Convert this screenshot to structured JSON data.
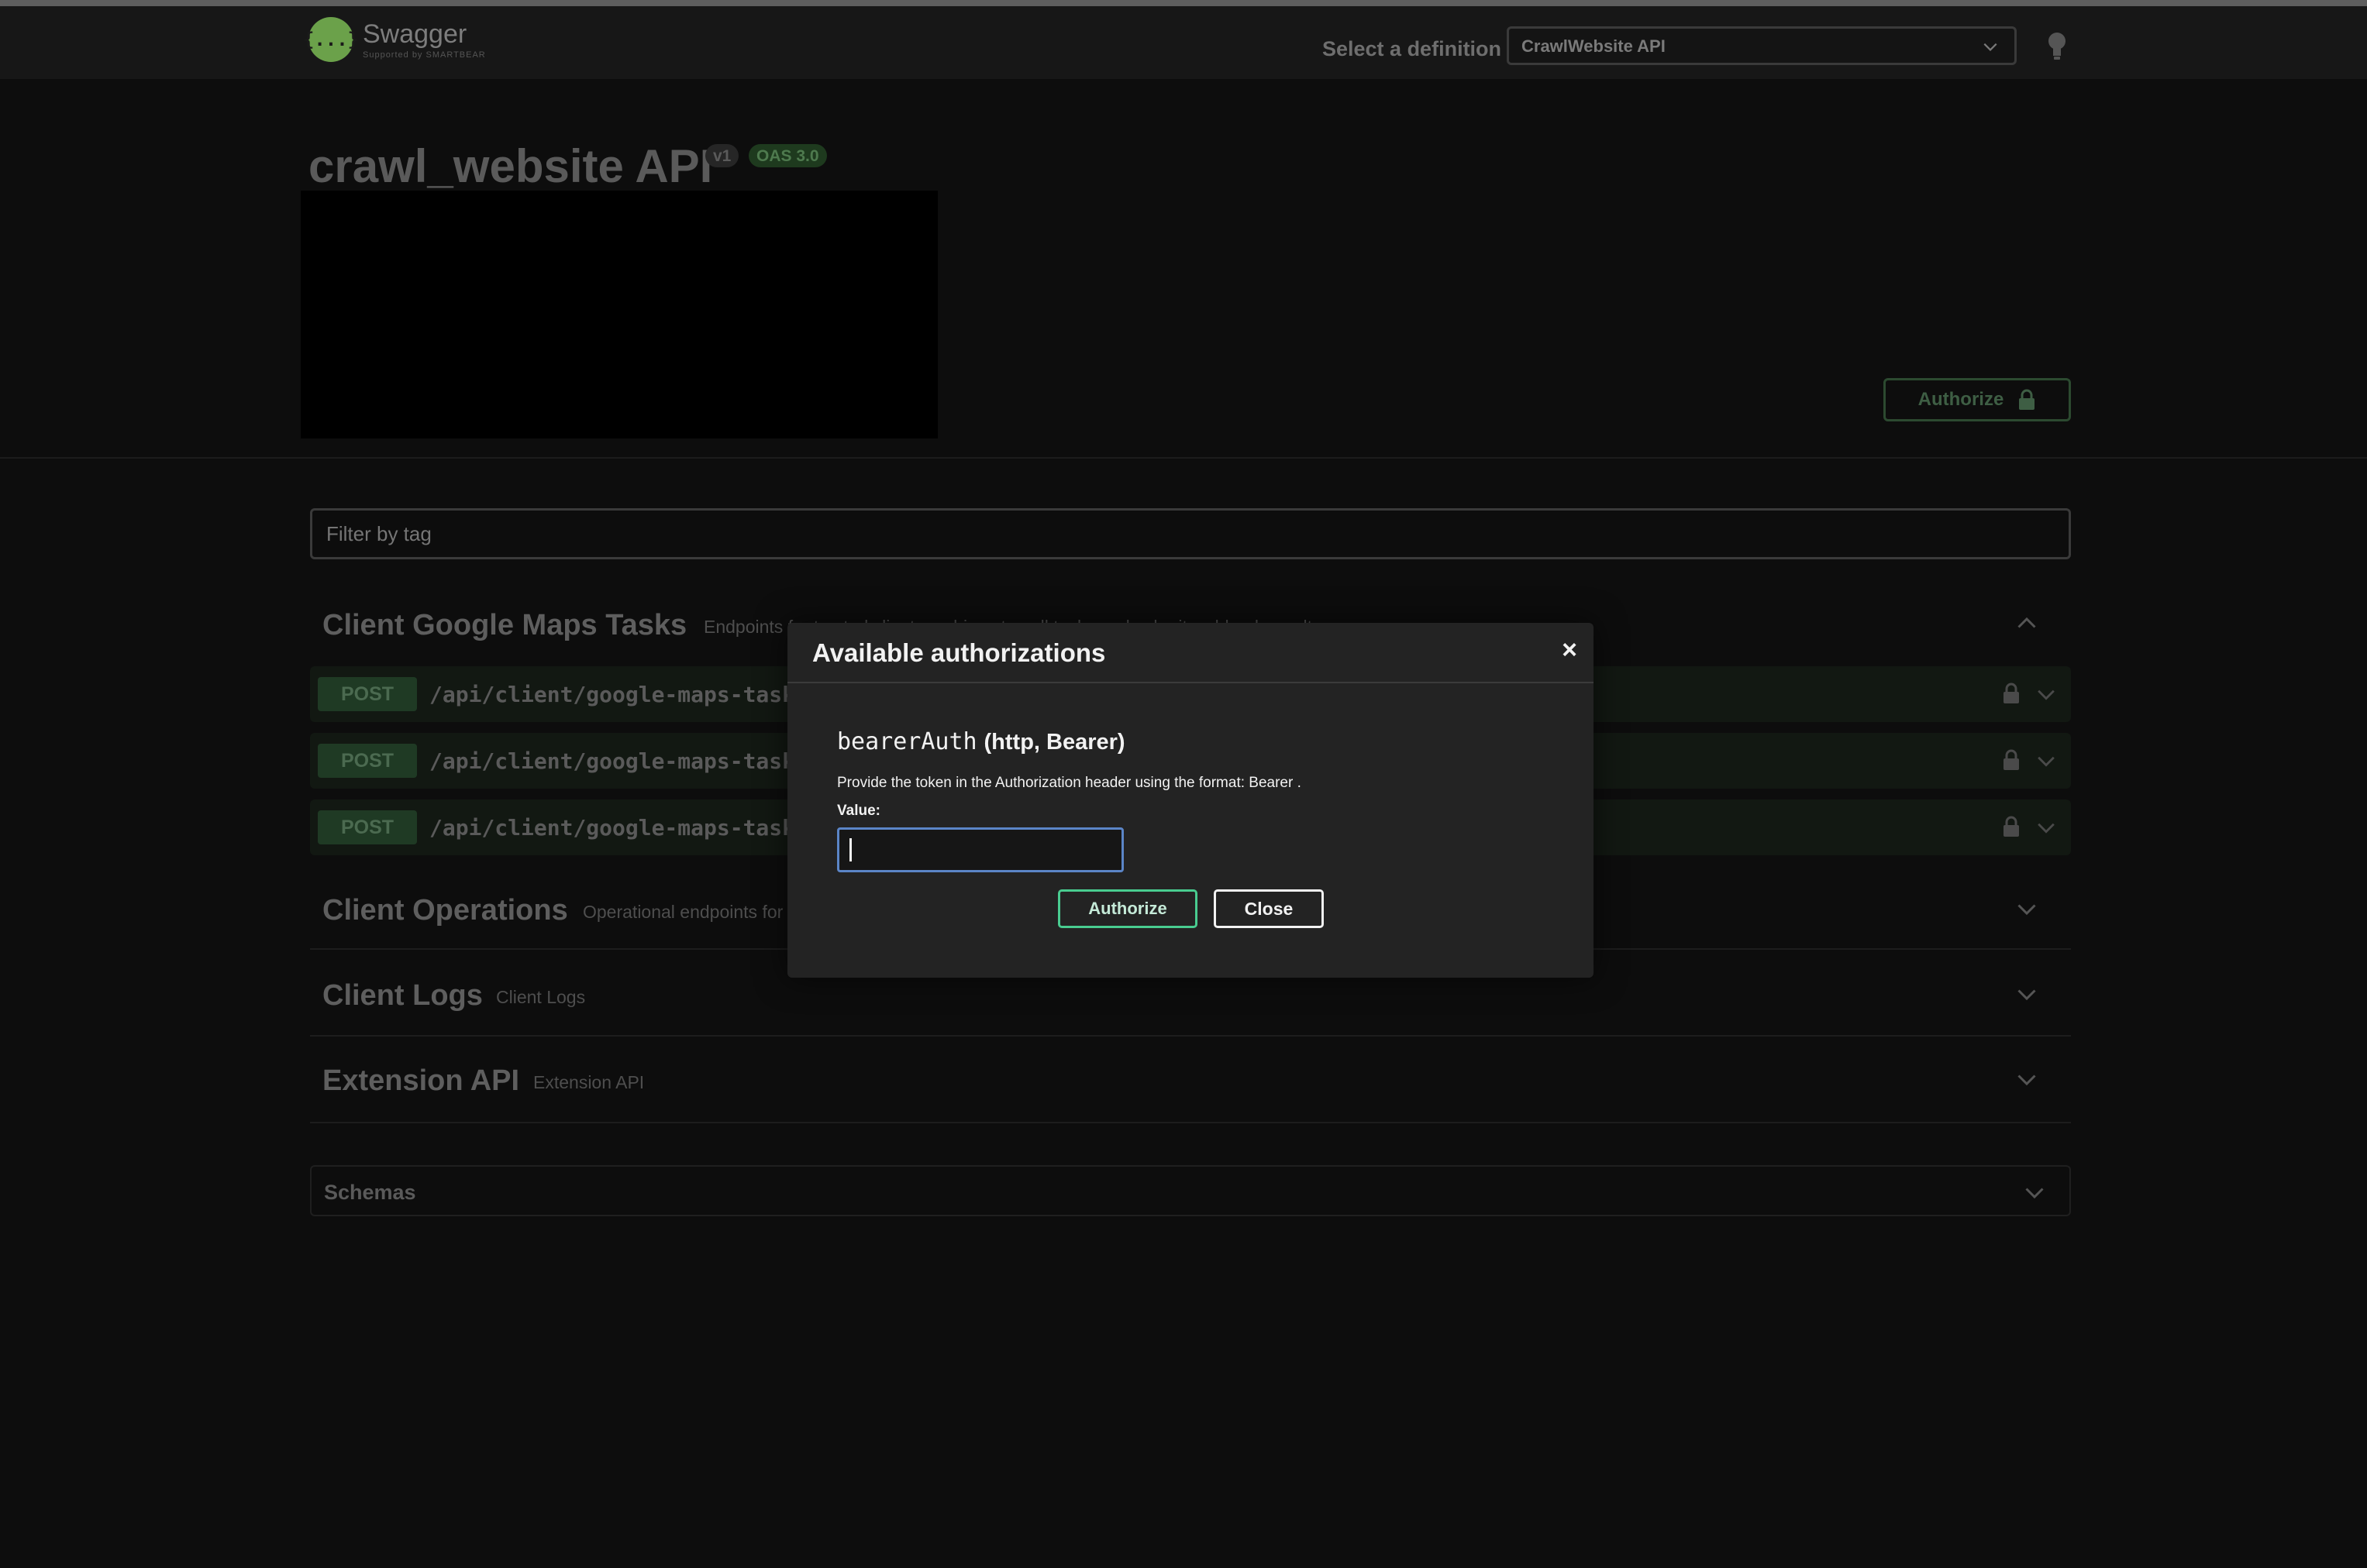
{
  "topbar": {
    "logo_icon": "{...}",
    "logo_name": "Swagger",
    "logo_sub": "Supported by SMARTBEAR",
    "definition_label": "Select a definition",
    "definition_value": "CrawlWebsite API"
  },
  "info": {
    "title": "crawl_website API",
    "version": "v1",
    "oas": "OAS 3.0",
    "authorize_label": "Authorize"
  },
  "filter": {
    "placeholder": "Filter by tag"
  },
  "tags": [
    {
      "name": "Client Google Maps Tasks",
      "description": "Endpoints for trusted client machines to pull tasks and submit webhook results."
    },
    {
      "name": "Client Operations",
      "description": "Operational endpoints for t"
    },
    {
      "name": "Client Logs",
      "description": "Client Logs"
    },
    {
      "name": "Extension API",
      "description": "Extension API"
    }
  ],
  "operations": [
    {
      "method": "POST",
      "path": "/api/client/google-maps-tasks/"
    },
    {
      "method": "POST",
      "path": "/api/client/google-maps-tasks/"
    },
    {
      "method": "POST",
      "path": "/api/client/google-maps-tasks/"
    }
  ],
  "schemas": {
    "label": "Schemas"
  },
  "modal": {
    "title": "Available authorizations",
    "close_x": "×",
    "scheme_name": "bearerAuth",
    "scheme_type": "(http, Bearer)",
    "description": "Provide the token in the Authorization header using the format: Bearer .",
    "value_label": "Value:",
    "value": "",
    "authorize_label": "Authorize",
    "close_label": "Close"
  },
  "colors": {
    "accent_green": "#49cc90",
    "input_focus": "#5b85c7",
    "background": "#0d0d0d",
    "modal_bg": "#232323"
  }
}
